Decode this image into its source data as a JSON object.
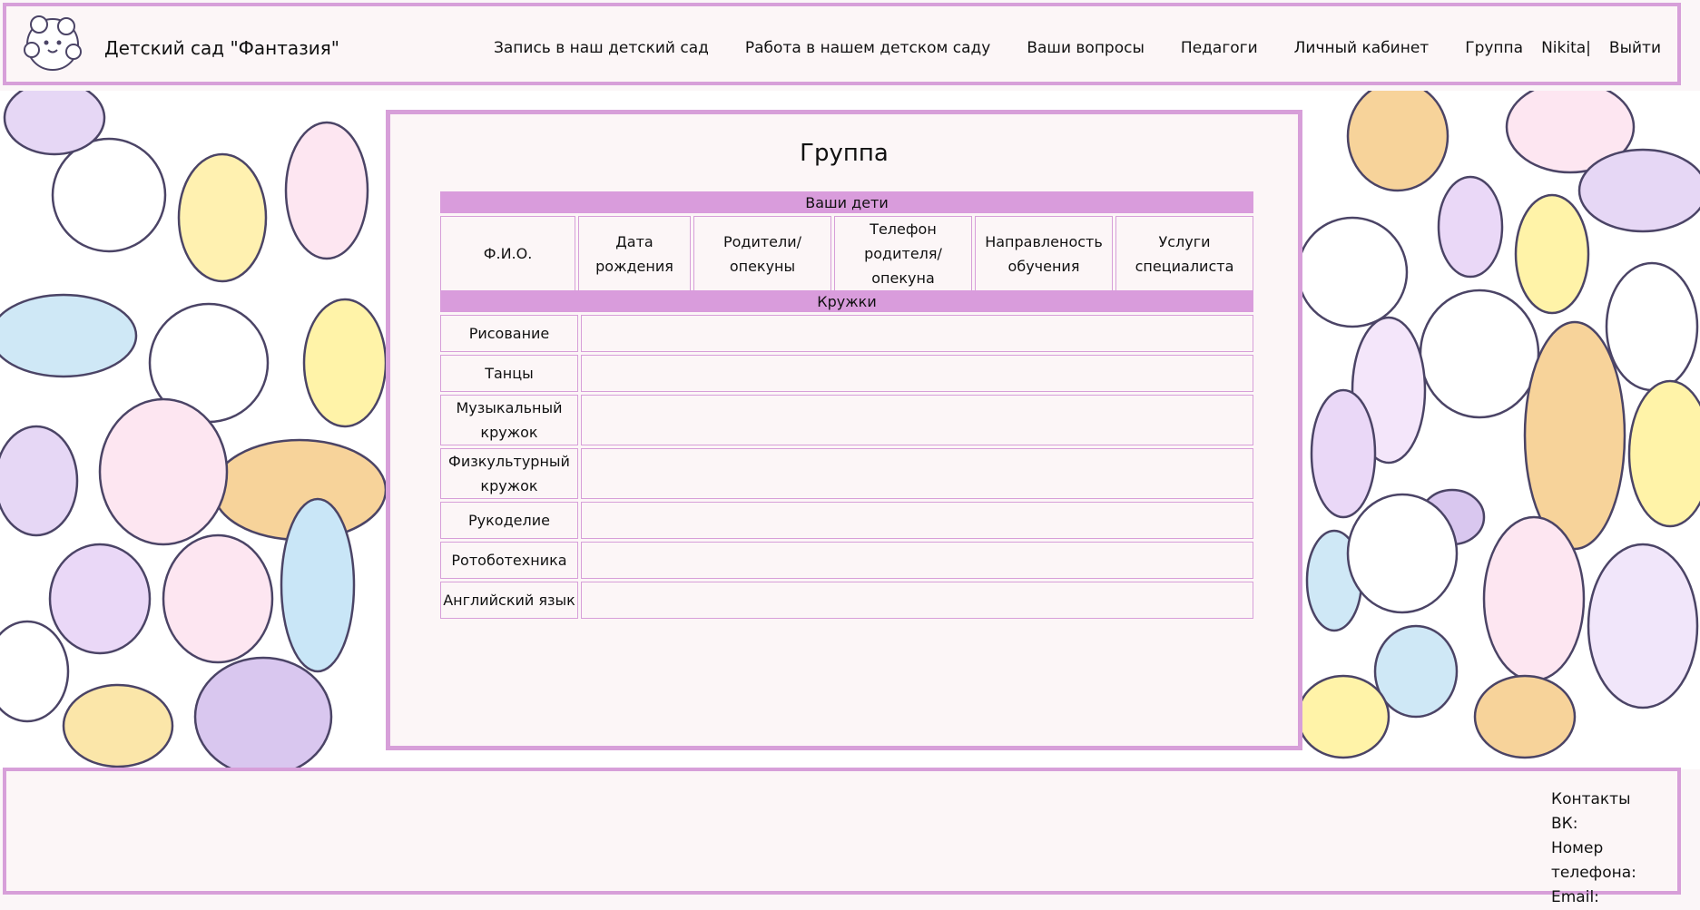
{
  "header": {
    "brand": "Детский сад \"Фантазия\"",
    "logo_icon": "cloud-ghost-logo",
    "nav": [
      "Запись в наш детский сад",
      "Работа в нашем детском саду",
      "Ваши вопросы",
      "Педагоги",
      "Личный кабинет",
      "Группа",
      "Nikita|",
      "Выйти"
    ]
  },
  "main": {
    "title": "Группа",
    "children_table": {
      "caption": "Ваши дети",
      "columns": [
        "Ф.И.О.",
        "Дата рождения",
        "Родители/ опекуны",
        "Телефон родителя/ опекуна",
        "Направленость обучения",
        "Услуги специалиста"
      ]
    },
    "clubs_table": {
      "caption": "Кружки",
      "rows": [
        "Рисование",
        "Танцы",
        "Музыкальный кружок",
        "Физкультурный кружок",
        "Рукоделие",
        "Ротоботехника",
        "Английский язык"
      ]
    }
  },
  "footer": {
    "lines": [
      "Контакты",
      "ВК:",
      "Номер телефона:",
      "Email:"
    ]
  },
  "colors": {
    "accent": "#d99cdc",
    "border": "#d79fd9",
    "panel_bg": "#fcf6f7"
  }
}
